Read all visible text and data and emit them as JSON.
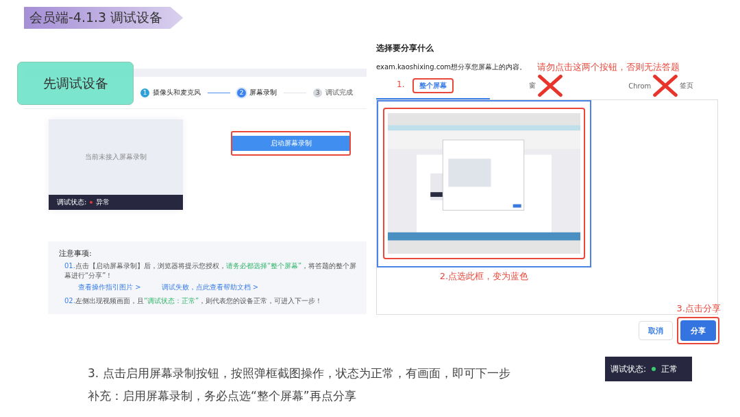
{
  "title": "会员端-4.1.3  调试设备",
  "callout": "先调试设备",
  "left_screen": {
    "steps": [
      {
        "number": "1",
        "label": "摄像头和麦克风",
        "done": true,
        "selected": false
      },
      {
        "number": "2",
        "label": "屏幕录制",
        "done": false,
        "selected": true
      },
      {
        "number": "3",
        "label": "调试完成",
        "done": false,
        "selected": false
      }
    ],
    "preview": {
      "message": "当前未接入屏幕录制",
      "status_label": "调试状态:",
      "status": "异常",
      "color": "#e53935"
    },
    "start_button": "启动屏幕录制",
    "notes": {
      "title": "注意事项:",
      "items": [
        {
          "number": "01.",
          "segments": [
            {
              "text": "点击【启动屏幕录制】后，浏览器将提示您授权，",
              "highlight": false
            },
            {
              "text": "请务必都选择“整个屏幕”",
              "highlight": true
            },
            {
              "text": "，将答题的整个屏幕进行“分享”！",
              "highlight": false
            }
          ],
          "links": [
            "查看操作指引图片 >",
            "调试失败，点此查看帮助文档 >"
          ]
        },
        {
          "number": "02.",
          "segments": [
            {
              "text": "左侧出现视频画面，且",
              "highlight": false
            },
            {
              "text": "“调试状态：正常”",
              "highlight": true
            },
            {
              "text": "，则代表您的设备正常，可进入下一步！",
              "highlight": false
            }
          ]
        }
      ]
    }
  },
  "share_dialog": {
    "title": "选择要分享什么",
    "subtitle": "exam.kaoshixing.com想分享您屏幕上的内容。",
    "tabs": [
      {
        "label": "整个屏幕",
        "selected": true,
        "blocked": false
      },
      {
        "label": "窗",
        "selected": false,
        "blocked": true
      },
      {
        "label": "Chrom",
        "label_end": "签页",
        "selected": false,
        "blocked": true
      }
    ],
    "screen_option": {
      "selected": true
    },
    "buttons": [
      {
        "label": "取消",
        "kind": "secondary"
      },
      {
        "label": "分享",
        "kind": "primary"
      }
    ]
  },
  "annotations": {
    "tabs_warning": "请勿点击这两个按钮，否则无法答题",
    "step1": "1.",
    "step2": "2.点选此框，变为蓝色",
    "step3": "3.点击分享"
  },
  "status_chip": {
    "label": "调试状态:",
    "status": "正常",
    "color": "#3ccf6e"
  },
  "footer": [
    "3. 点击启用屏幕录制按钮，按照弹框截图操作，状态为正常，有画面，即可下一步",
    "补充：启用屏幕录制，务必点选“整个屏幕”再点分享"
  ]
}
